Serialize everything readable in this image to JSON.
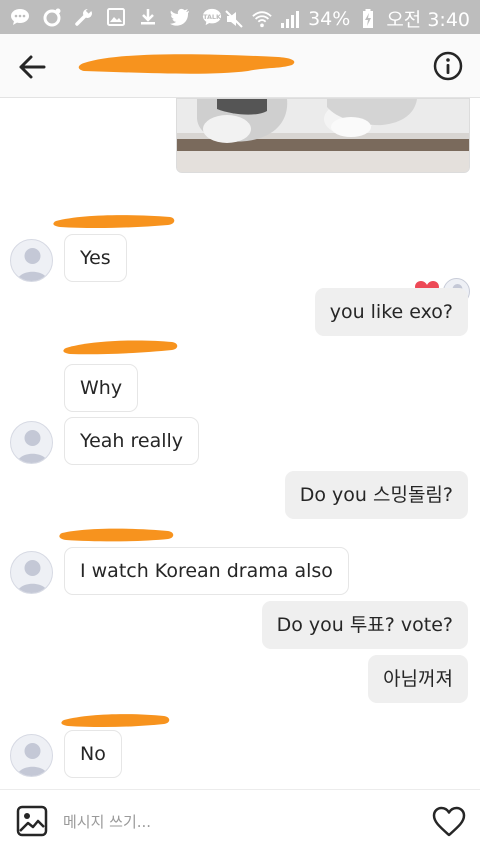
{
  "status_bar": {
    "battery": "34%",
    "time": "오전 3:40",
    "icons": [
      "message-icon",
      "camera-icon",
      "wrench-icon",
      "image-icon",
      "download-icon",
      "twitter-icon",
      "kakaotalk-icon",
      "mute-icon",
      "wifi-icon",
      "signal-icon",
      "battery-charging-icon"
    ]
  },
  "header": {
    "back_icon": "arrow-left-icon",
    "info_icon": "info-icon"
  },
  "conversation": {
    "incoming": [
      {
        "text": "Yes"
      },
      {
        "text": "Why"
      },
      {
        "text": "Yeah really"
      },
      {
        "text": "I watch Korean drama also"
      },
      {
        "text": "No"
      }
    ],
    "outgoing": [
      {
        "text": "you like exo?"
      },
      {
        "text": "Do you 스밍돌림?"
      },
      {
        "text": "Do you 투표? vote?"
      },
      {
        "text": "아님꺼져"
      }
    ]
  },
  "composer": {
    "placeholder": "메시지 쓰기...",
    "value": ""
  },
  "colors": {
    "status_bar_bg": "#bdbdbd",
    "redaction": "#f7931e",
    "heart": "#ed4956",
    "outgoing_bubble": "#efefef",
    "incoming_border": "#e6e6e6",
    "text": "#262626"
  }
}
